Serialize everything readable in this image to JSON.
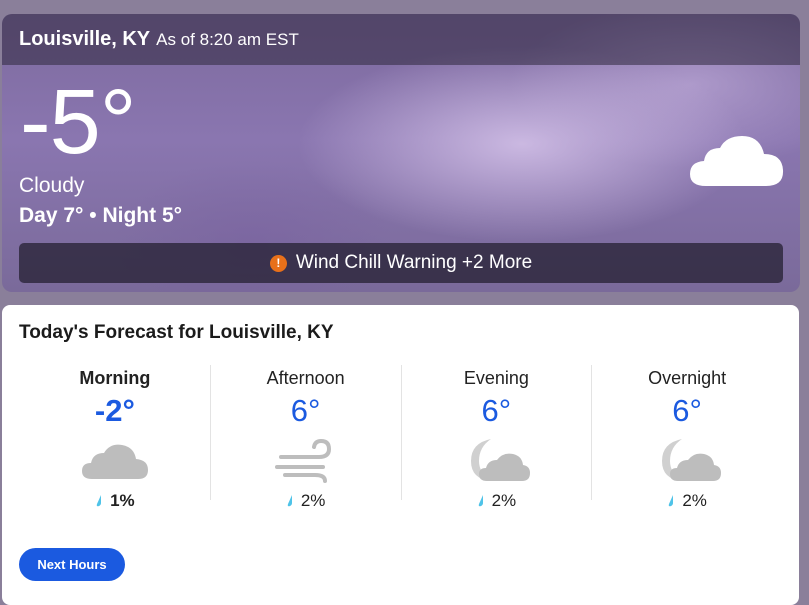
{
  "header": {
    "location": "Louisville, KY",
    "as_of": "As of 8:20 am EST"
  },
  "current": {
    "temperature": "-5°",
    "phrase": "Cloudy",
    "day_night": "Day 7° • Night 5°",
    "icon": "cloud-icon"
  },
  "alert": {
    "icon": "exclamation-icon",
    "text": "Wind Chill Warning +2 More",
    "icon_color": "#e8701a"
  },
  "forecast": {
    "title": "Today's Forecast for Louisville, KY",
    "periods": [
      {
        "label": "Morning",
        "temp": "-2°",
        "icon": "cloud-icon",
        "precip": "1%"
      },
      {
        "label": "Afternoon",
        "temp": "6°",
        "icon": "wind-icon",
        "precip": "2%"
      },
      {
        "label": "Evening",
        "temp": "6°",
        "icon": "moon-cloud-icon",
        "precip": "2%"
      },
      {
        "label": "Overnight",
        "temp": "6°",
        "icon": "moon-cloud-icon",
        "precip": "2%"
      }
    ],
    "next_button": "Next Hours"
  },
  "colors": {
    "accent": "#1b5ae0",
    "drop": "#4fc3e8"
  }
}
